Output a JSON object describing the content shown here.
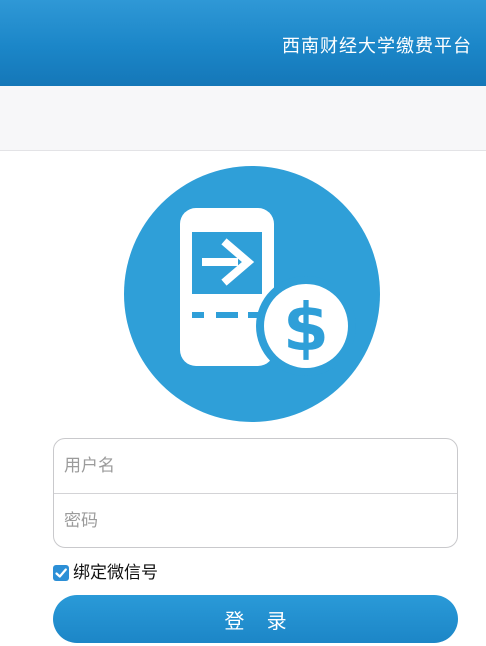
{
  "header": {
    "title": "西南财经大学缴费平台"
  },
  "logo": {
    "icon": "mobile-payment-icon",
    "circle_color": "#2f9fd8",
    "dollar_glyph": "$"
  },
  "form": {
    "username_placeholder": "用户名",
    "password_placeholder": "密码",
    "bind_wechat_label": "绑定微信号",
    "bind_wechat_checked": true,
    "login_label": "登 录"
  },
  "colors": {
    "accent": "#1b86c8",
    "checkbox": "#2c8fd6"
  }
}
